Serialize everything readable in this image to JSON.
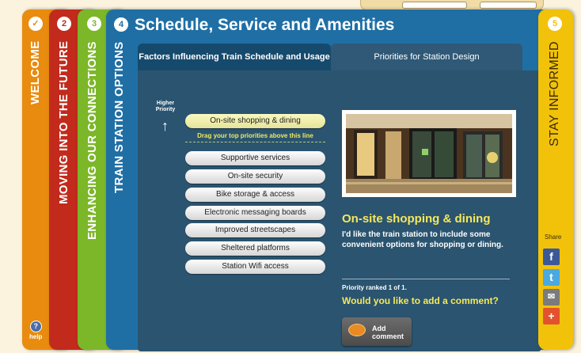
{
  "panels": {
    "welcome": {
      "num": "✓",
      "title": "WELCOME"
    },
    "future": {
      "num": "2",
      "title": "MOVING INTO THE FUTURE"
    },
    "connections": {
      "num": "3",
      "title": "ENHANCING OUR CONNECTIONS"
    },
    "station": {
      "num": "4",
      "title": "TRAIN STATION OPTIONS"
    },
    "informed": {
      "num": "5",
      "title": "STAY INFORMED"
    }
  },
  "help_label": "help",
  "main_title": "Schedule, Service and Amenities",
  "tabs": [
    {
      "label": "Factors Influencing Train Schedule and Usage"
    },
    {
      "label": "Priorities for Station Design"
    }
  ],
  "higher_priority_label": "Higher Priority",
  "top_priority": "On-site shopping & dining",
  "drag_hint": "Drag your top priorities above this line",
  "priority_items": [
    "Supportive services",
    "On-site security",
    "Bike storage & access",
    "Electronic messaging boards",
    "Improved streetscapes",
    "Sheltered platforms",
    "Station Wifi access"
  ],
  "featured": {
    "title": "On-site shopping & dining",
    "description": "I'd like the train station to include some convenient options for shopping or dining."
  },
  "rank_text": "Priority ranked 1 of 1.",
  "comment_question": "Would you like to add a comment?",
  "comment_button": "Add comment",
  "share": {
    "label": "Share",
    "buttons": [
      {
        "icon": "facebook-icon",
        "glyph": "f"
      },
      {
        "icon": "twitter-icon",
        "glyph": "t"
      },
      {
        "icon": "email-icon",
        "glyph": "✉"
      },
      {
        "icon": "add-icon",
        "glyph": "+"
      }
    ]
  }
}
